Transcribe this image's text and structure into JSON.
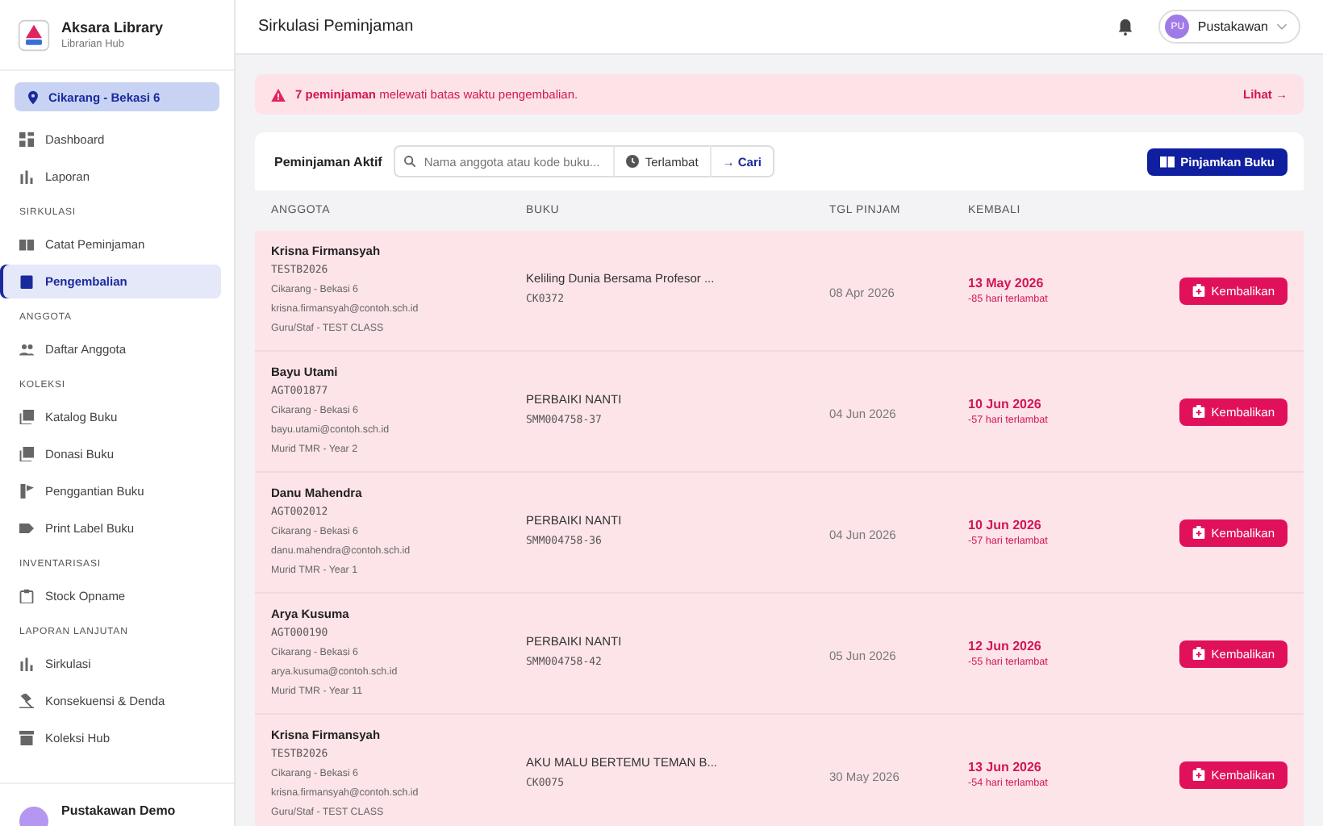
{
  "brand": {
    "title": "Aksara Library",
    "subtitle": "Librarian Hub"
  },
  "branch": {
    "label": "Cikarang - Bekasi 6"
  },
  "sidebar": {
    "sections": [
      {
        "items": [
          {
            "label": "Dashboard",
            "selected": false
          },
          {
            "label": "Laporan",
            "selected": false
          }
        ]
      },
      {
        "title": "SIRKULASI",
        "items": [
          {
            "label": "Catat Peminjaman",
            "selected": false
          },
          {
            "label": "Pengembalian",
            "selected": true
          }
        ]
      },
      {
        "title": "ANGGOTA",
        "items": [
          {
            "label": "Daftar Anggota",
            "selected": false
          }
        ]
      },
      {
        "title": "KOLEKSI",
        "items": [
          {
            "label": "Katalog Buku",
            "selected": false
          },
          {
            "label": "Donasi Buku",
            "selected": false
          },
          {
            "label": "Penggantian Buku",
            "selected": false
          },
          {
            "label": "Print Label Buku",
            "selected": false
          }
        ]
      },
      {
        "title": "INVENTARISASI",
        "items": [
          {
            "label": "Stock Opname",
            "selected": false
          }
        ]
      },
      {
        "title": "LAPORAN LANJUTAN",
        "items": [
          {
            "label": "Sirkulasi",
            "selected": false
          },
          {
            "label": "Konsekuensi & Denda",
            "selected": false
          },
          {
            "label": "Koleksi Hub",
            "selected": false
          }
        ]
      }
    ]
  },
  "user_footer": {
    "name": "Pustakawan Demo"
  },
  "header": {
    "title": "Sirkulasi Peminjaman",
    "user_initials": "PU",
    "user_name": "Pustakawan"
  },
  "alert": {
    "text": "**7 peminjaman** melewati batas waktu pengembalian.",
    "link": "Lihat →"
  },
  "panel": {
    "title": "Peminjaman Aktif",
    "search_placeholder": "Nama anggota atau kode buku...",
    "filter": "Terlambat",
    "search_button": "→ Cari",
    "primary_button": "Pinjamkan Buku"
  },
  "table": {
    "columns": [
      "ANGGOTA",
      "BUKU",
      "TGL PINJAM",
      "KEMBALI"
    ],
    "rows": [
      {
        "name": "Krisna Firmansyah",
        "code": "TESTB2026",
        "branch": "Cikarang - Bekasi 6",
        "email": "krisna.firmansyah@contoh.sch.id",
        "group": "Guru/Staf - TEST CLASS",
        "book": "Keliling Dunia Bersama Profesor ...",
        "book_code": "CK0372",
        "borrowed": "08 Apr 2026",
        "due": "13 May 2026",
        "late": "-85 hari terlambat",
        "overdue": true,
        "action": "Kembalikan"
      },
      {
        "name": "Bayu Utami",
        "code": "AGT001877",
        "branch": "Cikarang - Bekasi 6",
        "email": "bayu.utami@contoh.sch.id",
        "group": "Murid TMR - Year 2",
        "book": "PERBAIKI NANTI",
        "book_code": "SMM004758-37",
        "borrowed": "04 Jun 2026",
        "due": "10 Jun 2026",
        "late": "-57 hari terlambat",
        "overdue": true,
        "action": "Kembalikan"
      },
      {
        "name": "Danu Mahendra",
        "code": "AGT002012",
        "branch": "Cikarang - Bekasi 6",
        "email": "danu.mahendra@contoh.sch.id",
        "group": "Murid TMR - Year 1",
        "book": "PERBAIKI NANTI",
        "book_code": "SMM004758-36",
        "borrowed": "04 Jun 2026",
        "due": "10 Jun 2026",
        "late": "-57 hari terlambat",
        "overdue": true,
        "action": "Kembalikan"
      },
      {
        "name": "Arya Kusuma",
        "code": "AGT000190",
        "branch": "Cikarang - Bekasi 6",
        "email": "arya.kusuma@contoh.sch.id",
        "group": "Murid TMR - Year 11",
        "book": "PERBAIKI NANTI",
        "book_code": "SMM004758-42",
        "borrowed": "05 Jun 2026",
        "due": "12 Jun 2026",
        "late": "-55 hari terlambat",
        "overdue": true,
        "action": "Kembalikan"
      },
      {
        "name": "Krisna Firmansyah",
        "code": "TESTB2026",
        "branch": "Cikarang - Bekasi 6",
        "email": "krisna.firmansyah@contoh.sch.id",
        "group": "Guru/Staf - TEST CLASS",
        "book": "AKU MALU BERTEMU TEMAN B...",
        "book_code": "CK0075",
        "borrowed": "30 May 2026",
        "due": "13 Jun 2026",
        "late": "-54 hari terlambat",
        "overdue": true,
        "action": "Kembalikan"
      }
    ]
  }
}
